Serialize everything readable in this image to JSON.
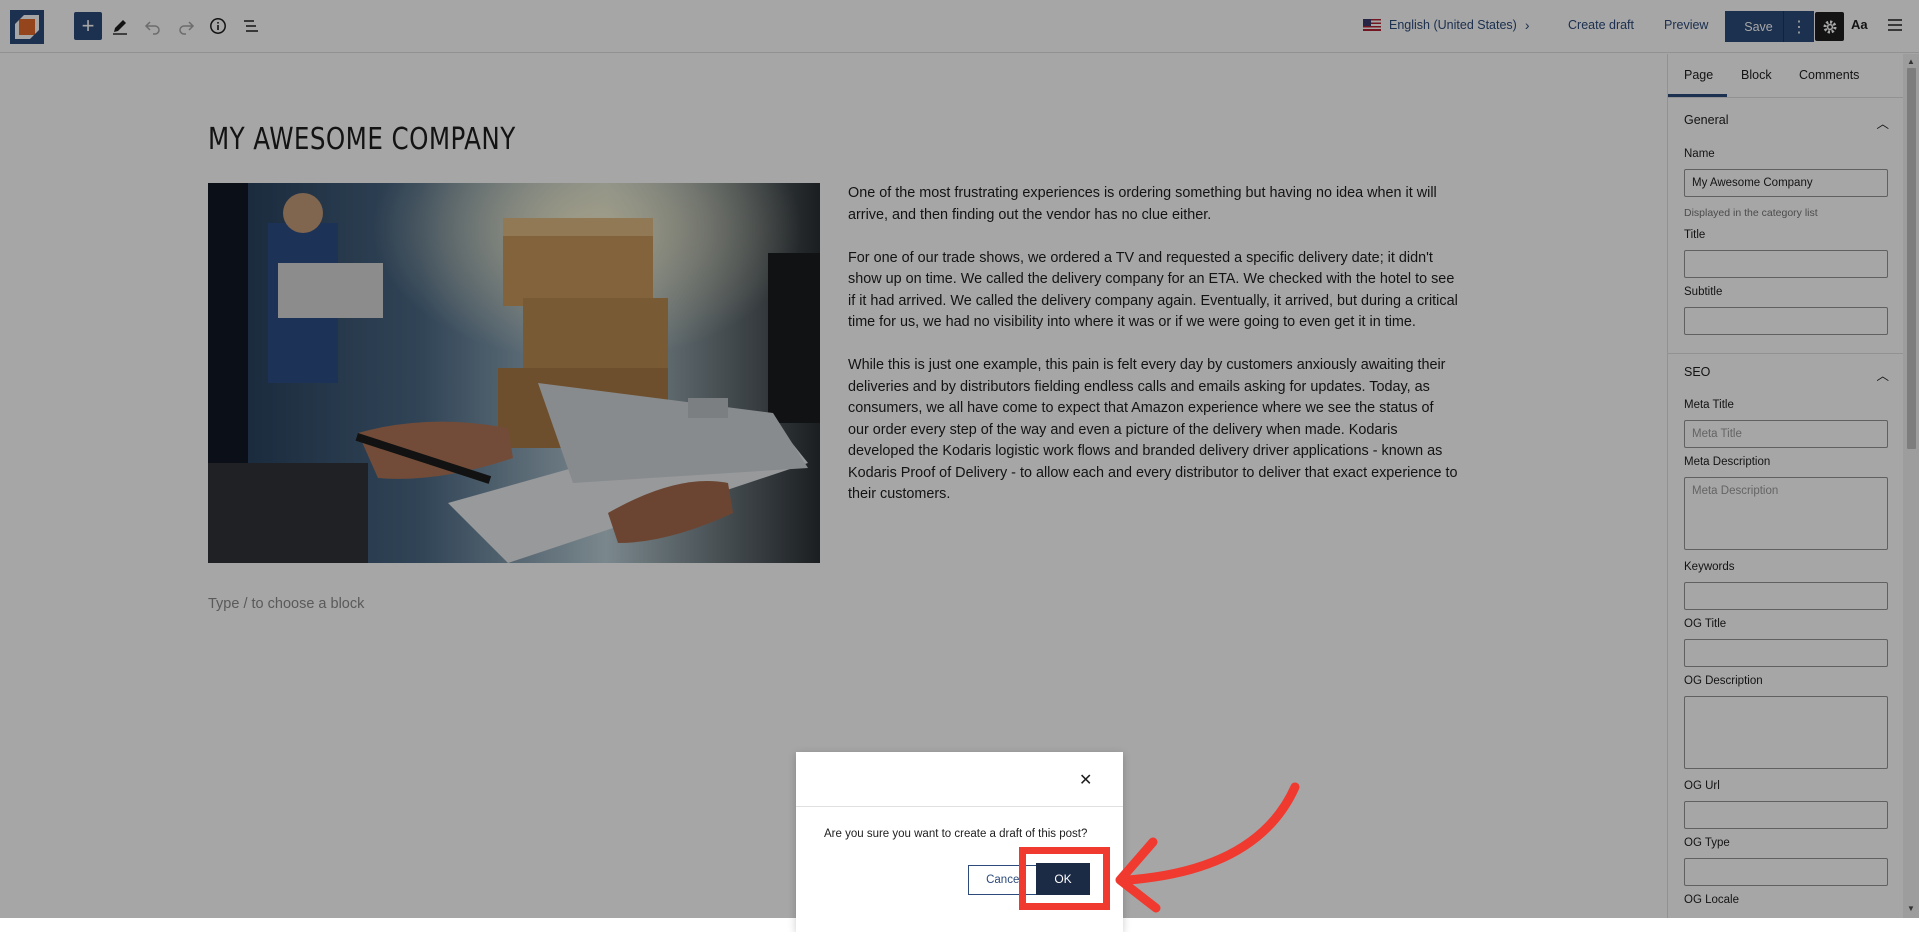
{
  "toolbar": {
    "language": "English (United States)",
    "create_draft": "Create draft",
    "preview": "Preview",
    "save": "Save",
    "font_toggle": "Aa"
  },
  "page": {
    "title": "MY AWESOME COMPANY",
    "paragraphs": [
      "One of the most frustrating experiences is ordering something but having no idea when it will arrive, and then finding out the vendor has no clue either.",
      "For one of our trade shows, we ordered a TV and requested a specific delivery date; it didn't show up on time. We called the delivery company for an ETA. We checked with the hotel to see if it had arrived. We called the delivery company again. Eventually, it arrived, but during a critical time for us, we had no visibility into where it was or if we were going to even get it in time.",
      "While this is just one example, this pain is felt every day by customers anxiously awaiting their deliveries and by distributors fielding endless calls and emails asking for updates. Today, as consumers, we all have come to expect that Amazon experience where we see the status of our order every step of the way and even a picture of the delivery when made. Kodaris developed the Kodaris logistic work flows and branded delivery driver applications - known as Kodaris Proof of Delivery - to allow each and every distributor to deliver that exact experience to their customers."
    ],
    "block_placeholder": "Type / to choose a block"
  },
  "sidebar": {
    "tabs": [
      "Page",
      "Block",
      "Comments"
    ],
    "general": {
      "heading": "General",
      "name_label": "Name",
      "name_value": "My Awesome Company",
      "name_hint": "Displayed in the category list",
      "title_label": "Title",
      "subtitle_label": "Subtitle"
    },
    "seo": {
      "heading": "SEO",
      "meta_title_label": "Meta Title",
      "meta_title_placeholder": "Meta Title",
      "meta_description_label": "Meta Description",
      "meta_description_placeholder": "Meta Description",
      "keywords_label": "Keywords",
      "og_title_label": "OG Title",
      "og_description_label": "OG Description",
      "og_url_label": "OG Url",
      "og_type_label": "OG Type",
      "og_locale_label": "OG Locale"
    }
  },
  "dialog": {
    "message": "Are you sure you want to create a draft of this post?",
    "cancel": "Cancel",
    "ok": "OK"
  },
  "colors": {
    "accent": "#2c4a7a",
    "highlight": "#f03a2f",
    "logo_orange": "#e36b2c"
  }
}
